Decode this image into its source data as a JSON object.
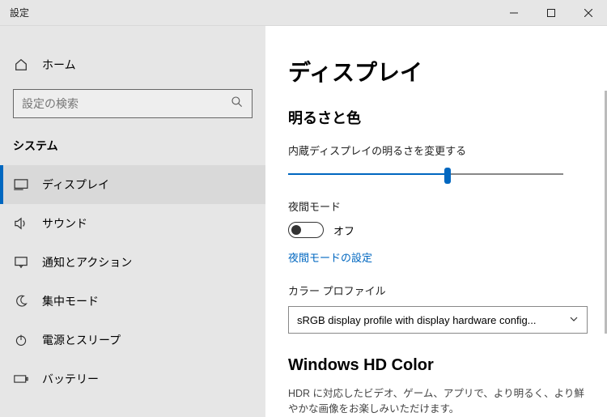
{
  "window": {
    "title": "設定"
  },
  "sidebar": {
    "home": "ホーム",
    "search_placeholder": "設定の検索",
    "category": "システム",
    "items": [
      {
        "label": "ディスプレイ",
        "icon": "monitor",
        "selected": true
      },
      {
        "label": "サウンド",
        "icon": "sound",
        "selected": false
      },
      {
        "label": "通知とアクション",
        "icon": "notification",
        "selected": false
      },
      {
        "label": "集中モード",
        "icon": "moon",
        "selected": false
      },
      {
        "label": "電源とスリープ",
        "icon": "power",
        "selected": false
      },
      {
        "label": "バッテリー",
        "icon": "battery",
        "selected": false
      }
    ]
  },
  "main": {
    "title": "ディスプレイ",
    "brightness_section": "明るさと色",
    "brightness_label": "内蔵ディスプレイの明るさを変更する",
    "brightness_value": 58,
    "night_label": "夜間モード",
    "night_state": "オフ",
    "night_settings_link": "夜間モードの設定",
    "color_profile_label": "カラー プロファイル",
    "color_profile_value": "sRGB display profile with display hardware config...",
    "hdr_title": "Windows HD Color",
    "hdr_desc": "HDR に対応したビデオ、ゲーム、アプリで、より明るく、より鮮やかな画像をお楽しみいただけます。"
  }
}
